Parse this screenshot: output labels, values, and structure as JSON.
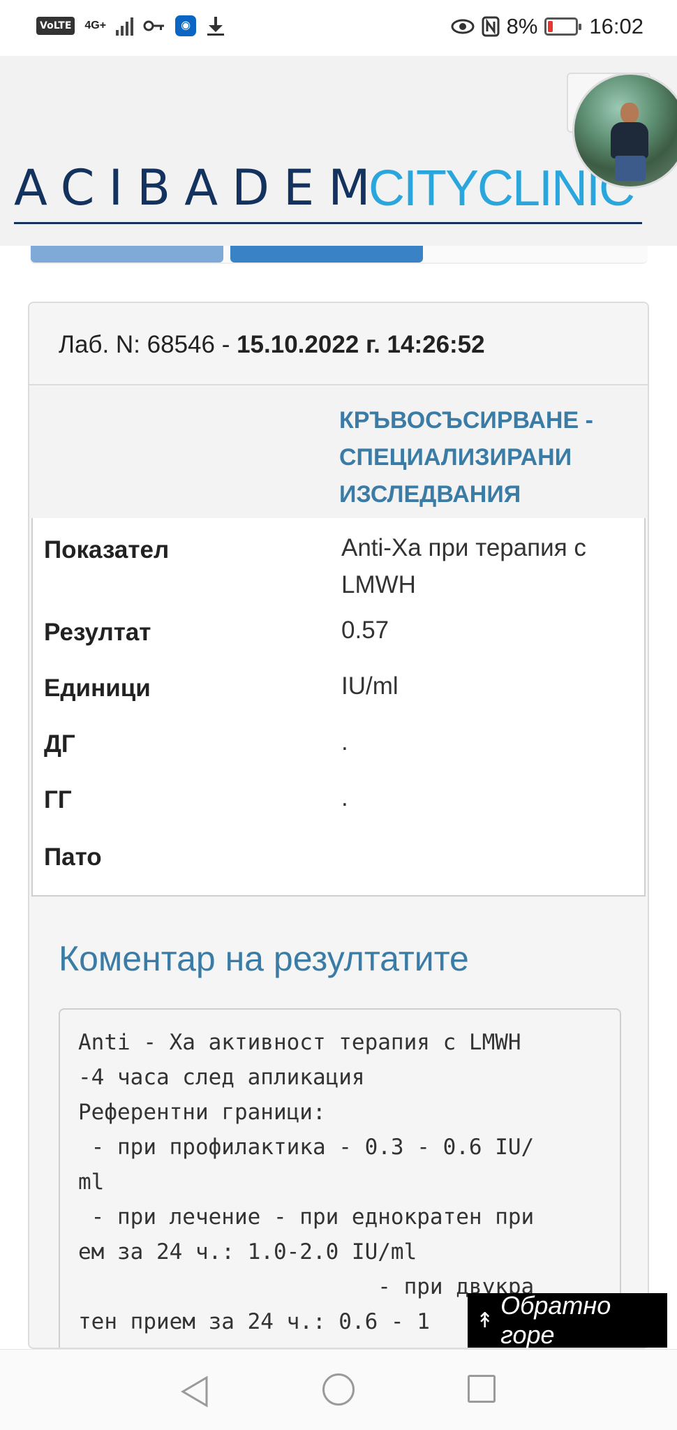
{
  "status_bar": {
    "volte": "VoLTE",
    "network": "4G+",
    "battery_percent": "8%",
    "time": "16:02",
    "icons": [
      "key-icon",
      "shield-icon",
      "download-icon",
      "eye-icon",
      "nfc-icon"
    ]
  },
  "header": {
    "logo_primary": "ACIBADEM",
    "logo_secondary": "CITYCLINIC"
  },
  "card": {
    "lab_prefix": "Лаб. N: 68546 - ",
    "lab_datetime": "15.10.2022 г. 14:26:52",
    "section_title": "КРЪВОСЪСИРВАНЕ - СПЕЦИАЛИЗИРАНИ ИЗСЛЕДВАНИЯ",
    "rows": [
      {
        "label": "Показател",
        "value": "Anti-Xa при терапия с LMWH"
      },
      {
        "label": "Резултат",
        "value": "0.57"
      },
      {
        "label": "Единици",
        "value": "IU/ml"
      },
      {
        "label": "ДГ",
        "value": "."
      },
      {
        "label": "ГГ",
        "value": "."
      },
      {
        "label": "Пато",
        "value": ""
      }
    ],
    "comment_title": "Коментар на резултатите",
    "comment_text": "Anti - Xa активност терапия с LMWH\n-4 часа след апликация\nРеферентни граници:\n - при профилактика - 0.3 - 0.6 IU/\nml\n - при лечение - при еднократен при\nем за 24 ч.: 1.0-2.0 IU/ml\n                       - при двукра\nтен прием за 24 ч.: 0.6 - 1"
  },
  "back_to_top": {
    "label": "Обратно горе"
  },
  "colors": {
    "accent_blue": "#3a7ca5",
    "logo_navy": "#13325e",
    "logo_cyan": "#2aa6dd",
    "battery_low": "#e5392f"
  }
}
